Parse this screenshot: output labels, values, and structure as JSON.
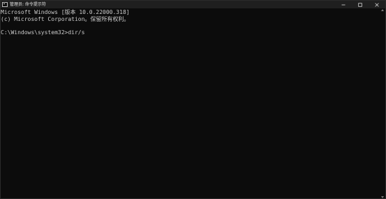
{
  "window": {
    "title": "管理员: 命令提示符",
    "app_icon": "cmd-icon",
    "controls": {
      "minimize_icon": "minimize-icon",
      "maximize_icon": "maximize-icon",
      "close_icon": "close-icon"
    }
  },
  "console": {
    "lines": [
      "Microsoft Windows [版本 10.0.22000.318]",
      "(c) Microsoft Corporation。保留所有权利。",
      "",
      "C:\\Windows\\system32>dir/s"
    ]
  },
  "colors": {
    "background": "#0c0c0c",
    "titlebar": "#1f1f1f",
    "text": "#cccccc"
  }
}
